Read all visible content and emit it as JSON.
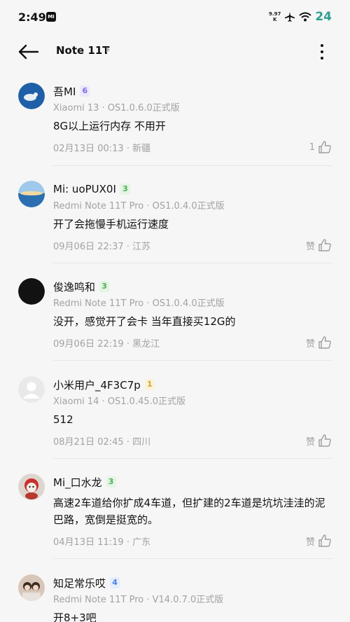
{
  "status_bar": {
    "time": "2:49",
    "app_icon_text": "MI",
    "net_speed_value": "9.97",
    "net_speed_unit": "K",
    "battery": "24"
  },
  "header": {
    "title": "Note 11T"
  },
  "comments": [
    {
      "user": "吾MI",
      "level": "6",
      "device": "Xiaomi 13 · OS1.0.6.0正式版",
      "content": "8G以上运行内存 不用开",
      "meta": "02月13日 00:13 · 新疆",
      "like": "1"
    },
    {
      "user": "Mi: uoPUX0I",
      "level": "3",
      "device": "Redmi Note 11T Pro · OS1.0.4.0正式版",
      "content": "开了会拖慢手机运行速度",
      "meta": "09月06日 22:37 · 江苏",
      "like": "赞"
    },
    {
      "user": "俊逸鸣和",
      "level": "3",
      "device": "Redmi Note 11T Pro · OS1.0.4.0正式版",
      "content": "没开，感觉开了会卡 当年直接买12G的",
      "meta": "09月06日 22:19 · 黑龙江",
      "like": "赞"
    },
    {
      "user": "小米用户_4F3C7p",
      "level": "1",
      "device": "Xiaomi 14 · OS1.0.45.0正式版",
      "content": "512",
      "meta": "08月21日 02:45 · 四川",
      "like": "赞"
    },
    {
      "user": "Mi_口水龙",
      "level": "3",
      "device": "",
      "content": "高速2车道给你扩成4车道，但扩建的2车道是坑坑洼洼的泥巴路，宽倒是挺宽的。",
      "meta": "04月13日 11:19 · 广东",
      "like": "赞"
    },
    {
      "user": "知足常乐哎",
      "level": "4",
      "device": "Redmi Note 11T Pro · V14.0.7.0正式版",
      "content": "开8+3吧",
      "meta": "",
      "like": ""
    }
  ],
  "colors": {
    "accent_battery": "#2f9e91",
    "secondary_text": "#a2a2a2",
    "background": "#f6f6f6"
  }
}
